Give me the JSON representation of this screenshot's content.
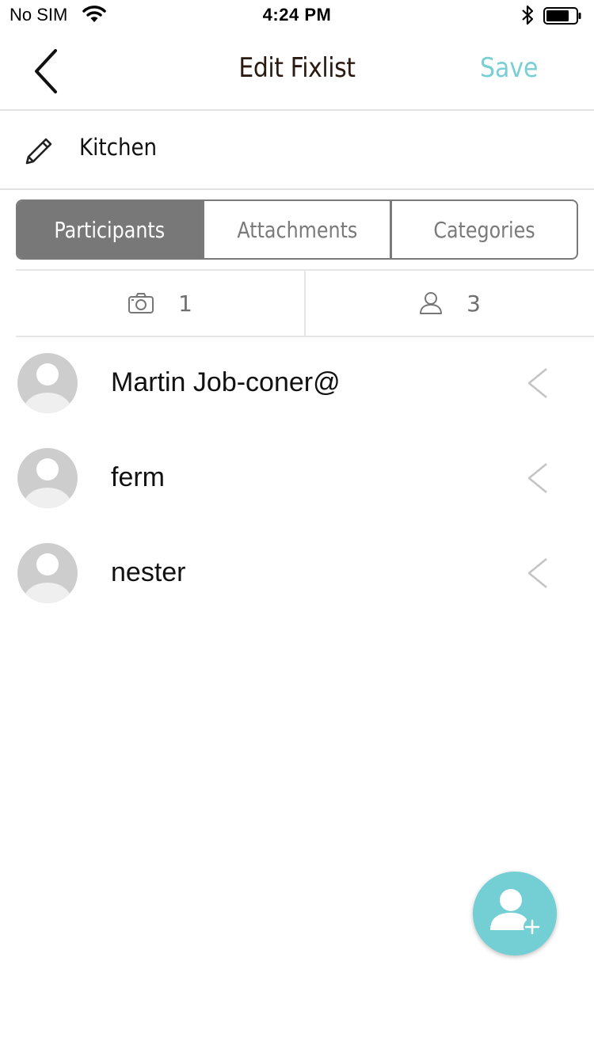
{
  "status_bar": {
    "carrier": "No SIM",
    "time": "4:24 PM",
    "icons": [
      "wifi-icon",
      "bluetooth-icon",
      "battery-icon"
    ]
  },
  "nav": {
    "back_icon": "chevron-left-icon",
    "title": "Edit Fixlist",
    "save_label": "Save"
  },
  "name_field": {
    "icon": "pencil-icon",
    "value": "Kitchen"
  },
  "tabs": [
    {
      "label": "Participants",
      "active": true
    },
    {
      "label": "Attachments",
      "active": false
    },
    {
      "label": "Categories",
      "active": false
    }
  ],
  "stats": {
    "photos": {
      "icon": "camera-icon",
      "count": "1"
    },
    "participants": {
      "icon": "person-icon",
      "count": "3"
    }
  },
  "participants": [
    {
      "name": "Martin Job-coner@",
      "action_icon": "chevron-left-icon"
    },
    {
      "name": "ferm",
      "action_icon": "chevron-left-icon"
    },
    {
      "name": "nester",
      "action_icon": "chevron-left-icon"
    }
  ],
  "fab": {
    "icon": "add-person-icon"
  },
  "colors": {
    "accent": "#79cfd3",
    "fab": "#74cfd4",
    "active_tab": "#787878",
    "title": "#2a1a12"
  }
}
